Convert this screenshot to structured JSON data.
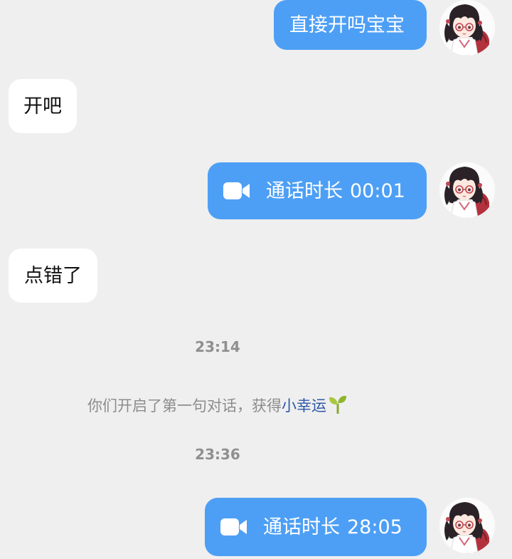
{
  "messages": {
    "m1": {
      "text": "直接开吗宝宝"
    },
    "m2": {
      "text": "开吧"
    },
    "m3": {
      "label": "通话时长",
      "duration": "00:01",
      "icon": "video-camera-icon"
    },
    "m4": {
      "text": "点错了"
    },
    "m5": {
      "label": "通话时长",
      "duration": "28:05",
      "icon": "video-camera-icon"
    }
  },
  "system": {
    "time1": "23:14",
    "notice_prefix": "你们开启了第一句对话，获得",
    "notice_highlight": "小幸运",
    "notice_icon": "sprout-icon",
    "time2": "23:36"
  },
  "colors": {
    "outgoing_bubble": "#4d9ff5",
    "incoming_bubble": "#ffffff",
    "background": "#efefef",
    "highlight_text": "#2d58a8"
  }
}
